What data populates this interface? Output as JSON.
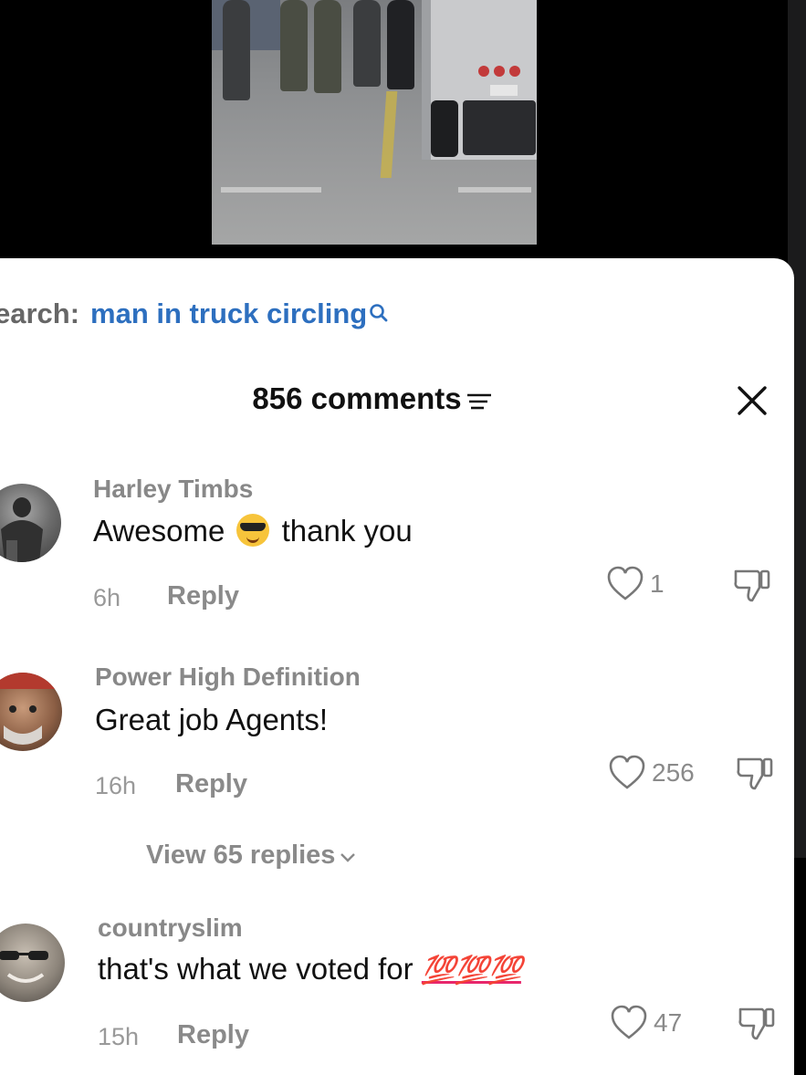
{
  "search": {
    "prefix": "earch:",
    "term": "man in truck circling"
  },
  "comments_panel": {
    "title": "856 comments"
  },
  "comments": [
    {
      "username": "Harley Timbs",
      "text_before": "Awesome",
      "emoji": "smiling-face-with-sunglasses",
      "text_after": "thank you",
      "time": "6h",
      "reply_label": "Reply",
      "likes": "1"
    },
    {
      "username": "Power High Definition",
      "text": "Great job Agents!",
      "time": "16h",
      "reply_label": "Reply",
      "likes": "256",
      "view_replies": "View 65 replies"
    },
    {
      "username": "countryslim",
      "text": "that's what we voted for",
      "emoji_text": "💯💯💯",
      "time": "15h",
      "reply_label": "Reply",
      "likes": "47"
    }
  ],
  "colors": {
    "search_term": "#2d6fbf",
    "hundred_emoji": "#e8266b"
  },
  "icons": [
    "search-icon",
    "filter-icon",
    "close-icon",
    "heart-icon",
    "thumbs-down-icon",
    "chevron-down-icon"
  ]
}
